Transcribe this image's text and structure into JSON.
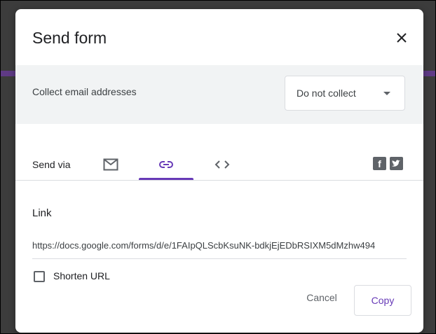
{
  "dialog": {
    "title": "Send form",
    "close_icon": "close-icon"
  },
  "collect": {
    "label": "Collect email addresses",
    "selected": "Do not collect"
  },
  "send_via": {
    "label": "Send via",
    "tabs": [
      {
        "icon": "email-icon",
        "active": false
      },
      {
        "icon": "link-icon",
        "active": true
      },
      {
        "icon": "embed-code-icon",
        "active": false
      }
    ],
    "social": [
      {
        "icon": "facebook-icon",
        "glyph": "f"
      },
      {
        "icon": "twitter-icon",
        "glyph": ""
      }
    ]
  },
  "link": {
    "label": "Link",
    "url": "https://docs.google.com/forms/d/e/1FAIpQLScbKsuNK-bdkjEjEDbRSIXM5dMzhw494",
    "shorten_label": "Shorten URL",
    "shorten_checked": false
  },
  "actions": {
    "cancel": "Cancel",
    "copy": "Copy"
  },
  "colors": {
    "accent": "#673ab7",
    "band": "#f1f3f4"
  }
}
